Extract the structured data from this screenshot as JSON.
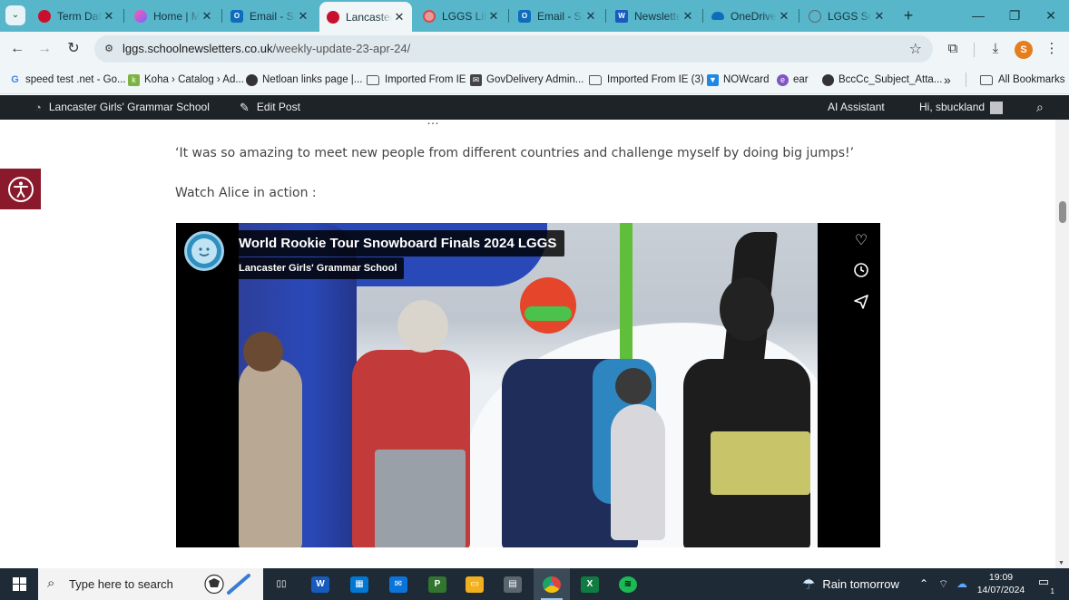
{
  "browser": {
    "tabs": [
      {
        "title": "Term Dates",
        "favicon": "red-circle-icon",
        "color": "#c8102e"
      },
      {
        "title": "Home | My",
        "favicon": "gradient-flower-icon",
        "color": "#7b61ff"
      },
      {
        "title": "Email - Sa",
        "favicon": "outlook-icon",
        "color": "#0f6cbd"
      },
      {
        "title": "Lancaster",
        "favicon": "red-circle-icon",
        "color": "#c8102e",
        "active": true
      },
      {
        "title": "LGGS Life",
        "favicon": "red-crest-icon",
        "color": "#d64b4b"
      },
      {
        "title": "Email - Sa",
        "favicon": "outlook-icon",
        "color": "#0f6cbd"
      },
      {
        "title": "Newsletter",
        "favicon": "word-icon",
        "color": "#185abd"
      },
      {
        "title": "OneDrive",
        "favicon": "onedrive-cloud-icon",
        "color": "#0f6cbd"
      },
      {
        "title": "LGGS Sch",
        "favicon": "globe-icon",
        "color": "#5f6368"
      }
    ],
    "url": {
      "host": "lggs.schoolnewsletters.co.uk",
      "path": "/weekly-update-23-apr-24/"
    },
    "profile_initial": "S",
    "bookmarks": [
      {
        "label": "speed test .net - Go...",
        "icon": "google-icon",
        "color": "#4285f4"
      },
      {
        "label": "Koha › Catalog › Ad...",
        "icon": "koha-icon",
        "color": "#7cb342"
      },
      {
        "label": "Netloan links page |...",
        "icon": "globe-icon",
        "color": "#333333"
      },
      {
        "label": "Imported From IE",
        "icon": "folder-icon"
      },
      {
        "label": "GovDelivery Admin...",
        "icon": "govdelivery-icon",
        "color": "#444444"
      },
      {
        "label": "Imported From IE (3)",
        "icon": "folder-icon"
      },
      {
        "label": "NOWcard",
        "icon": "nowcard-icon",
        "color": "#1e88e5"
      },
      {
        "label": "ear",
        "icon": "ear-icon",
        "color": "#7e57c2"
      },
      {
        "label": "BccCc_Subject_Atta...",
        "icon": "globe-icon",
        "color": "#333333"
      }
    ],
    "bookmarks_more": "»",
    "all_bookmarks": "All Bookmarks"
  },
  "adminbar": {
    "site_name": "Lancaster Girls' Grammar School",
    "edit_post": "Edit Post",
    "ai_assistant": "AI Assistant",
    "greeting": "Hi, sbuckland"
  },
  "article": {
    "quote": "‘It was so amazing to meet new people from different countries and challenge myself by doing big jumps!’",
    "watch_line": "Watch Alice in action :"
  },
  "video": {
    "title": "World Rookie Tour Snowboard Finals 2024 LGGS",
    "channel": "Lancaster Girls' Grammar School",
    "side_icons": [
      "heart-icon",
      "clock-icon",
      "share-icon"
    ]
  },
  "taskbar": {
    "search_placeholder": "Type here to search",
    "apps": [
      {
        "name": "task-view",
        "label": "▯▯",
        "color": "#1e2b36"
      },
      {
        "name": "word",
        "label": "W",
        "color": "#185abd"
      },
      {
        "name": "store",
        "label": "▦",
        "color": "#0078d4"
      },
      {
        "name": "mail",
        "label": "✉",
        "color": "#0a74da"
      },
      {
        "name": "project",
        "label": "P",
        "color": "#31752f"
      },
      {
        "name": "file-explorer",
        "label": "▭",
        "color": "#f2b01e"
      },
      {
        "name": "calculator",
        "label": "▤",
        "color": "#5a6670"
      },
      {
        "name": "chrome",
        "label": "●",
        "color": "#e0443e",
        "active": true
      },
      {
        "name": "excel",
        "label": "X",
        "color": "#107c41"
      },
      {
        "name": "spotify",
        "label": "≋",
        "color": "#1db954"
      }
    ],
    "weather": "Rain tomorrow",
    "time": "19:09",
    "date": "14/07/2024",
    "notification_count": "1"
  }
}
